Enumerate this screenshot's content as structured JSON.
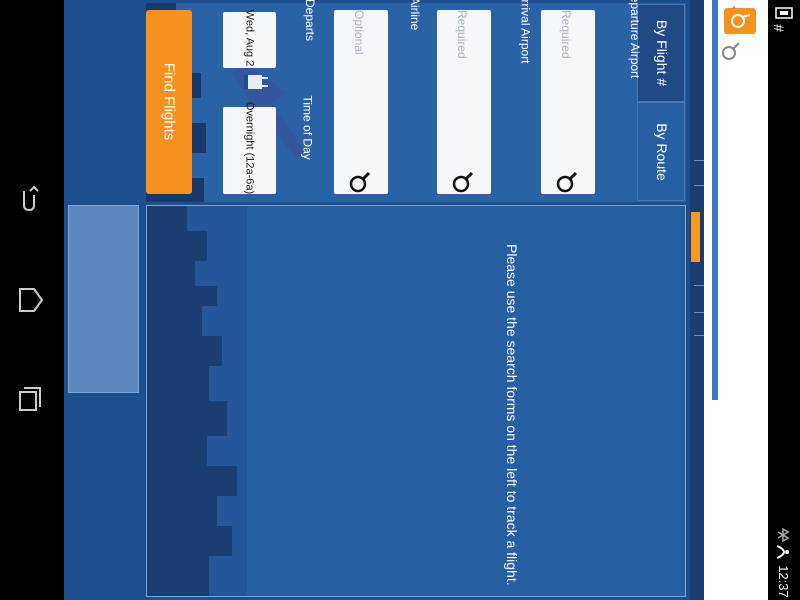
{
  "system": {
    "clock": "12:37",
    "nav_icons": [
      "back-icon",
      "home-icon",
      "recent-apps-icon"
    ],
    "status_icons": [
      "wifi-icon",
      "bluetooth-icon",
      "battery-icon"
    ]
  },
  "colors": {
    "app_bg": "#1d4e8e",
    "panel_bg": "#2a62a6",
    "accent_orange": "#f5911e",
    "field_bg": "#f6f7f9"
  },
  "tabs": [
    {
      "label": "By Flight #",
      "selected": true
    },
    {
      "label": "By Route",
      "selected": false
    }
  ],
  "form": {
    "departure_airport_label": "Departure Airport",
    "departure_airport_placeholder": "Required",
    "arrival_airport_label": "Arrival Airport",
    "arrival_airport_placeholder": "Required",
    "airline_label": "Airline",
    "airline_placeholder": "Optional",
    "departs_label": "Departs",
    "departs_value": "Wed, Aug 2",
    "time_of_day_label": "Time of Day",
    "time_of_day_value": "Overnight (12a-6a)",
    "find_button_label": "Find Flights"
  },
  "results": {
    "message": "Please use the search forms on the left to track a flight."
  }
}
